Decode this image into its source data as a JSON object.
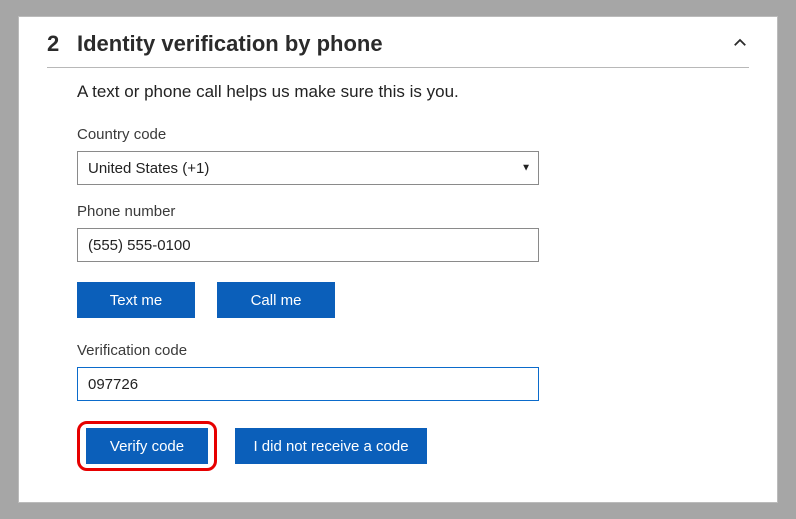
{
  "step_number": "2",
  "header_title": "Identity verification by phone",
  "subtitle": "A text or phone call helps us make sure this is you.",
  "fields": {
    "country_code": {
      "label": "Country code",
      "value": "United States (+1)"
    },
    "phone_number": {
      "label": "Phone number",
      "value": "(555) 555-0100"
    },
    "verification_code": {
      "label": "Verification code",
      "value": "097726"
    }
  },
  "buttons": {
    "text_me": "Text me",
    "call_me": "Call me",
    "verify_code": "Verify code",
    "no_code": "I did not receive a code"
  }
}
